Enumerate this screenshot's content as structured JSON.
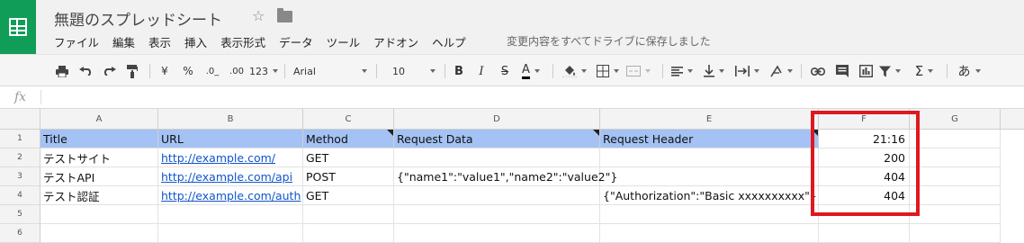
{
  "app": {
    "title": "無題のスプレッドシート",
    "menu": [
      "ファイル",
      "編集",
      "表示",
      "挿入",
      "表示形式",
      "データ",
      "ツール",
      "アドオン",
      "ヘルプ"
    ],
    "save_status": "変更内容をすべてドライブに保存しました"
  },
  "toolbar": {
    "currency": "¥",
    "percent": "%",
    "dec_minus": ".0_",
    "dec_plus": ".00",
    "more_formats": "123",
    "font": "Arial",
    "font_size": "10",
    "bold": "B",
    "italic": "I",
    "strike": "S",
    "text_color": "A",
    "input_tool": "あ"
  },
  "sheet": {
    "columns": [
      "A",
      "B",
      "C",
      "D",
      "E",
      "F",
      "G"
    ],
    "rows": [
      "1",
      "2",
      "3",
      "4",
      "5",
      "6"
    ],
    "cells": {
      "r1": {
        "a": "Title",
        "b": "URL",
        "c": "Method",
        "d": "Request Data",
        "e": "Request Header",
        "f": "21:16"
      },
      "r2": {
        "a": "テストサイト",
        "b": "http://example.com/",
        "c": "GET",
        "d": "",
        "e": "",
        "f": "200"
      },
      "r3": {
        "a": "テストAPI",
        "b": "http://example.com/api",
        "c": "POST",
        "d": "{\"name1\":\"value1\",\"name2\":\"value2\"}",
        "e": "",
        "f": "404"
      },
      "r4": {
        "a": "テスト認証",
        "b": "http://example.com/auth",
        "c": "GET",
        "d": "",
        "e": "{\"Authorization\":\"Basic xxxxxxxxxx\"}",
        "f": "404"
      }
    }
  },
  "colors": {
    "logo_green": "#0f9d58",
    "header_fill": "#a4c2f4",
    "link": "#1155cc",
    "highlight_border": "#e0171e"
  }
}
